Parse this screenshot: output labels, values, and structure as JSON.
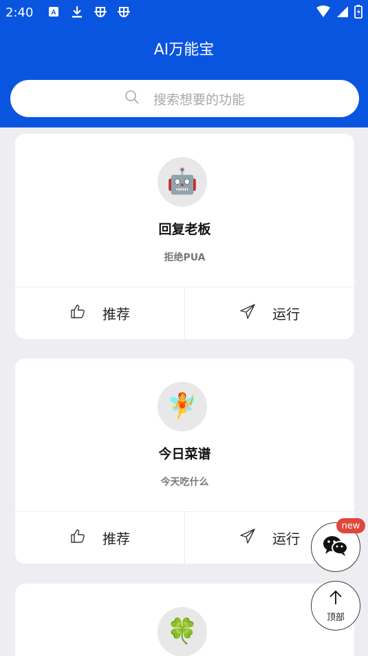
{
  "status_bar": {
    "time": "2:40",
    "icons_left": [
      "a-keyboard-icon",
      "download-icon",
      "bug-icon",
      "bug-icon"
    ],
    "icons_right": [
      "wifi-icon",
      "signal-icon",
      "battery-icon"
    ]
  },
  "header": {
    "title": "AI万能宝",
    "background": "#0a55e0"
  },
  "search": {
    "placeholder": "搜索想要的功能"
  },
  "cards": [
    {
      "icon": "robot-icon",
      "emoji": "🤖",
      "title": "回复老板",
      "subtitle": "拒绝PUA",
      "recommend_label": "推荐",
      "run_label": "运行"
    },
    {
      "icon": "fairy-icon",
      "emoji": "🧚",
      "title": "今日菜谱",
      "subtitle": "今天吃什么",
      "recommend_label": "推荐",
      "run_label": "运行"
    },
    {
      "icon": "four-leaf-clover-icon",
      "emoji": "🍀"
    }
  ],
  "floating": {
    "wechat_badge": "new",
    "top_label": "顶部"
  }
}
